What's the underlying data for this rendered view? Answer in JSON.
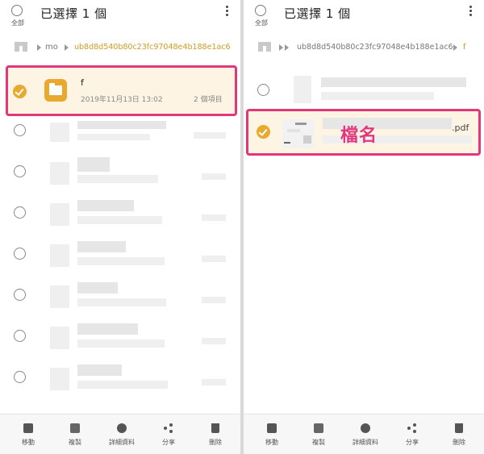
{
  "left": {
    "header": {
      "select_all_label": "全部",
      "title": "已選擇 1 個"
    },
    "breadcrumb": {
      "crumbs": [
        "mo",
        "ub8d8d540b80c23fc97048e4b188e1ac6"
      ]
    },
    "selected_item": {
      "name": "f",
      "date": "2019年11月13日 13:02",
      "count": "2 個項目"
    },
    "blurred_rows": 7
  },
  "right": {
    "header": {
      "select_all_label": "全部",
      "title": "已選擇 1 個"
    },
    "breadcrumb": {
      "crumbs": [
        "ub8d8d540b80c23fc97048e4b188e1ac6",
        "f"
      ]
    },
    "selected_file": {
      "ext": ".pdf",
      "annotation": "檔名"
    }
  },
  "toolbar": {
    "move": "移動",
    "copy": "複製",
    "details": "詳細資料",
    "share": "分享",
    "delete": "刪除"
  },
  "colors": {
    "accent": "#e8a92e",
    "highlight": "#e3377c"
  },
  "icons": [
    "home-icon",
    "folder-icon",
    "move-icon",
    "copy-icon",
    "info-icon",
    "share-icon",
    "trash-icon",
    "kebab-menu-icon"
  ]
}
